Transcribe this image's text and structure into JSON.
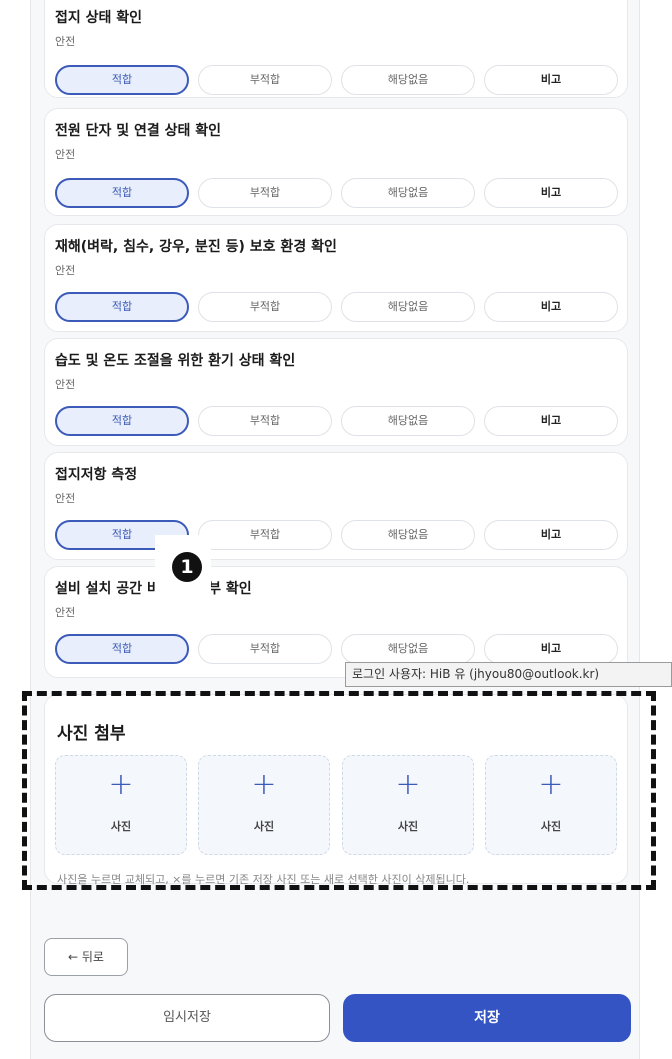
{
  "checklist": [
    {
      "title": "접지 상태 확인",
      "category": "안전",
      "selected": "적합"
    },
    {
      "title": "전원 단자 및 연결 상태 확인",
      "category": "안전",
      "selected": "적합"
    },
    {
      "title": "재해(벼락, 침수, 강우, 분진 등) 보호 환경 확인",
      "category": "안전",
      "selected": "적합"
    },
    {
      "title": "습도 및 온도 조절을 위한 환기 상태 확인",
      "category": "안전",
      "selected": "적합"
    },
    {
      "title": "접지저항 측정",
      "category": "안전",
      "selected": "적합"
    },
    {
      "title": "설비 설치 공간 비 동작 여부 확인",
      "category": "안전",
      "selected": "적합"
    }
  ],
  "options": {
    "fit": "적합",
    "unfit": "부적합",
    "na": "해당없음",
    "remark": "비고"
  },
  "tooltip": "로그인 사용자: HiB 유 (jhyou80@outlook.kr)",
  "marker": "1",
  "photos": {
    "title": "사진 첨부",
    "slot_label": "사진",
    "plus_icon": "+",
    "hint": "사진을 누르면 교체되고, ×를 누르면 기존 저장 사진 또는 새로 선택한 사진이 삭제됩니다."
  },
  "buttons": {
    "back": "← 뒤로",
    "temp_save": "임시저장",
    "save": "저장"
  },
  "colors": {
    "accent": "#3c5ab8",
    "save_bg": "#3454c4"
  }
}
